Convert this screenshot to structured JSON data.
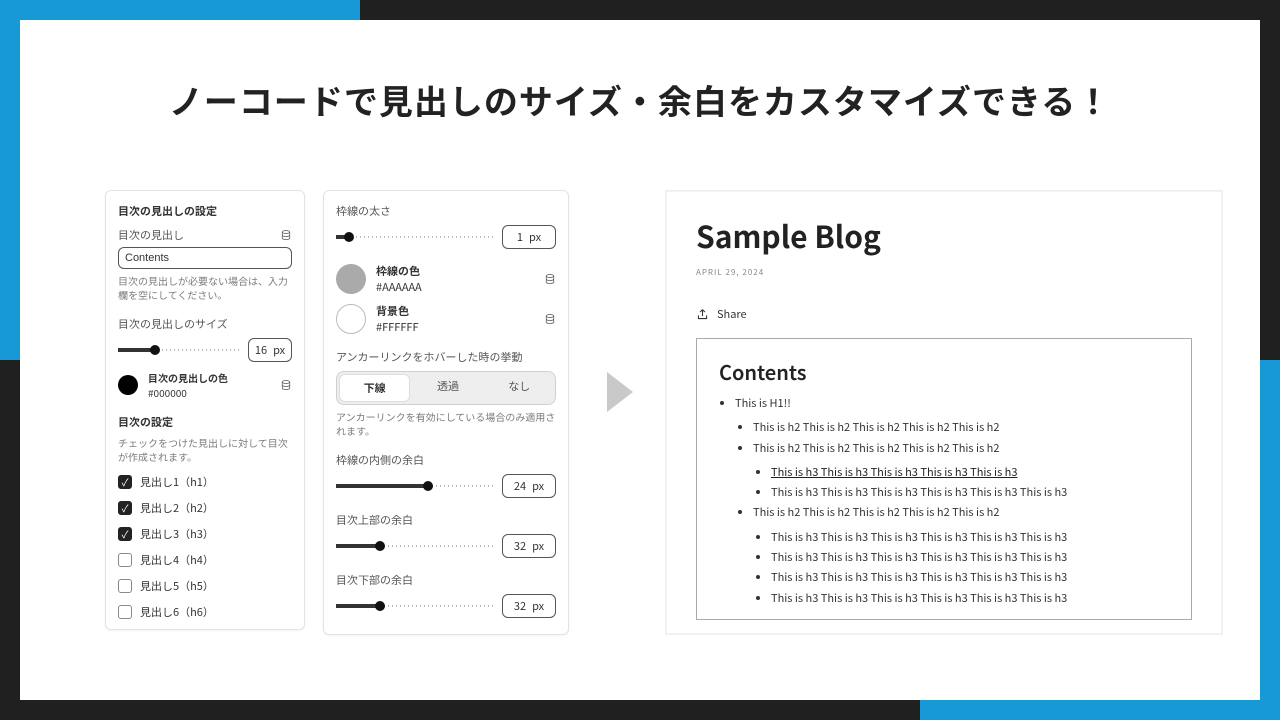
{
  "headline": "ノーコードで見出しのサイズ・余白をカスタマイズできる！",
  "panelA": {
    "title": "目次の見出しの設定",
    "headingLabel": "目次の見出し",
    "inputValue": "Contents",
    "inputHelp": "目次の見出しが必要ない場合は、入力欄を空にしてください。",
    "sizeLabel": "目次の見出しのサイズ",
    "sizeValue": "16",
    "sizeUnit": "px",
    "colorLabel": "目次の見出しの色",
    "colorValue": "#000000",
    "tocTitle": "目次の設定",
    "tocHelp": "チェックをつけた見出しに対して目次が作成されます。",
    "checks": [
      {
        "label": "見出し1（h1）",
        "checked": true
      },
      {
        "label": "見出し2（h2）",
        "checked": true
      },
      {
        "label": "見出し3（h3）",
        "checked": true
      },
      {
        "label": "見出し4（h4）",
        "checked": false
      },
      {
        "label": "見出し5（h5）",
        "checked": false
      },
      {
        "label": "見出し6（h6）",
        "checked": false
      }
    ]
  },
  "panelB": {
    "borderWidthLabel": "枠線の太さ",
    "borderWidthValue": "1",
    "unit": "px",
    "borderColorLabel": "枠線の色",
    "borderColorValue": "#AAAAAA",
    "bgColorLabel": "背景色",
    "bgColorValue": "#FFFFFF",
    "hoverLabel": "アンカーリンクをホバーした時の挙動",
    "hoverOptions": [
      "下線",
      "透過",
      "なし"
    ],
    "hoverHelp": "アンカーリンクを有効にしている場合のみ適用されます。",
    "innerPadLabel": "枠線の内側の余白",
    "innerPadValue": "24",
    "topMarginLabel": "目次上部の余白",
    "topMarginValue": "32",
    "bottomMarginLabel": "目次下部の余白",
    "bottomMarginValue": "32"
  },
  "preview": {
    "title": "Sample Blog",
    "date": "APRIL 29, 2024",
    "shareLabel": "Share",
    "tocTitle": "Contents",
    "items": {
      "h1": "This is H1!!",
      "h2a": "This is h2 This is h2 This is h2 This is h2 This is h2",
      "h2b": "This is h2 This is h2 This is h2 This is h2 This is h2",
      "h3a": "This is h3 This is h3 This is h3 This is h3 This is h3",
      "h3b": "This is h3 This is h3 This is h3 This is h3 This is h3 This is h3",
      "h2c": "This is h2 This is h2 This is h2 This is h2 This is h2",
      "h3c": "This is h3 This is h3 This is h3 This is h3 This is h3 This is h3",
      "h3d": "This is h3 This is h3 This is h3 This is h3 This is h3 This is h3",
      "h3e": "This is h3 This is h3 This is h3 This is h3 This is h3 This is h3",
      "h3f": "This is h3 This is h3 This is h3 This is h3 This is h3 This is h3"
    }
  }
}
